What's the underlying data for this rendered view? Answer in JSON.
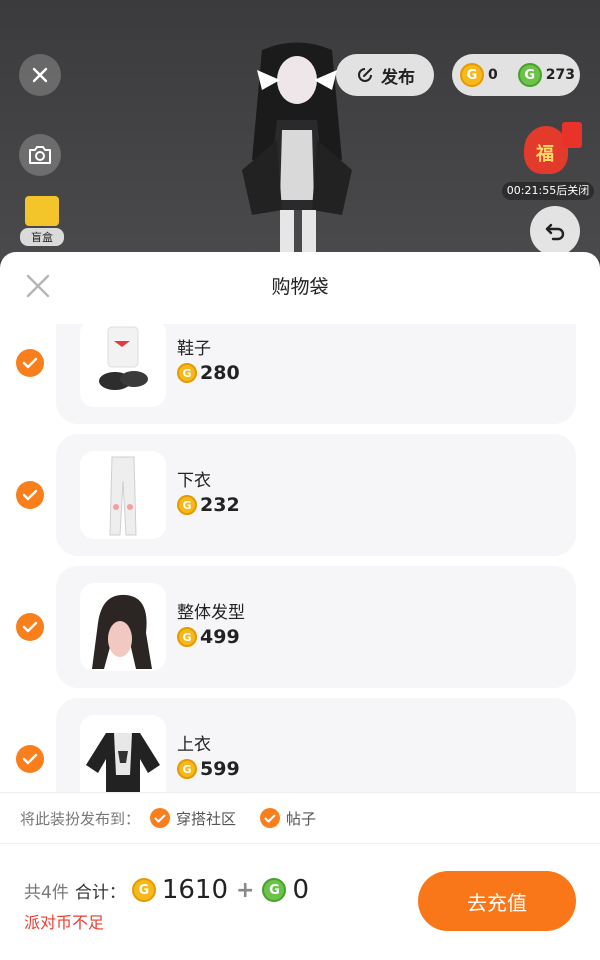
{
  "topbar": {
    "publish_label": "发布",
    "currency_gold": "0",
    "currency_green": "273",
    "coin_glyph": "G",
    "blindbox_label": "盲盒",
    "fortune_glyph": "福",
    "fortune_timer": "00:21:55后关闭"
  },
  "sheet": {
    "title": "购物袋",
    "items": [
      {
        "name": "鞋子",
        "price": "280",
        "icon": "shoes-icon",
        "checked": true
      },
      {
        "name": "下衣",
        "price": "232",
        "icon": "leggings-icon",
        "checked": true
      },
      {
        "name": "整体发型",
        "price": "499",
        "icon": "hairstyle-icon",
        "checked": true
      },
      {
        "name": "上衣",
        "price": "599",
        "icon": "top-icon",
        "checked": true
      }
    ],
    "publish_to": {
      "label": "将此装扮发布到：",
      "options": [
        "穿搭社区",
        "帖子"
      ]
    },
    "footer": {
      "count": "共4件",
      "sum_label": "合计：",
      "gold_total": "1610",
      "plus": "+",
      "green_total": "0",
      "warning": "派对币不足",
      "recharge_label": "去充值"
    }
  },
  "colors": {
    "accent": "#f97718",
    "warning": "#ea3c2f",
    "gold_coin": "#f6b81a",
    "green_coin": "#6cc24a"
  }
}
